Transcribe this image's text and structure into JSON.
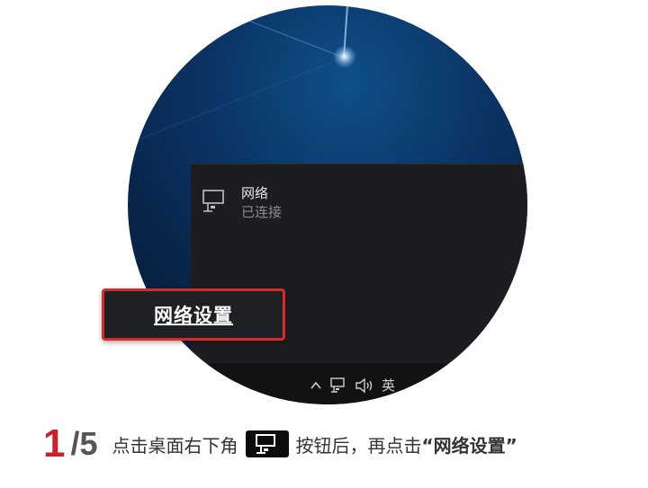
{
  "flyout": {
    "network_name": "网络",
    "network_status": "已连接"
  },
  "highlight_button": {
    "label": "网络设置"
  },
  "taskbar": {
    "ime_label": "英"
  },
  "caption": {
    "step_current": "1",
    "step_separator": "/",
    "step_total": "5",
    "text_before": "点击桌面右下角",
    "text_after": "按钮后，再点击",
    "quoted_target": "“网络设置”"
  },
  "icons": [
    "network-icon",
    "chevron-up-icon",
    "network-tray-icon",
    "volume-icon"
  ],
  "colors": {
    "accent_red": "#c8232c",
    "highlight_border": "#d42b2b",
    "panel_bg": "#1c1d21"
  }
}
